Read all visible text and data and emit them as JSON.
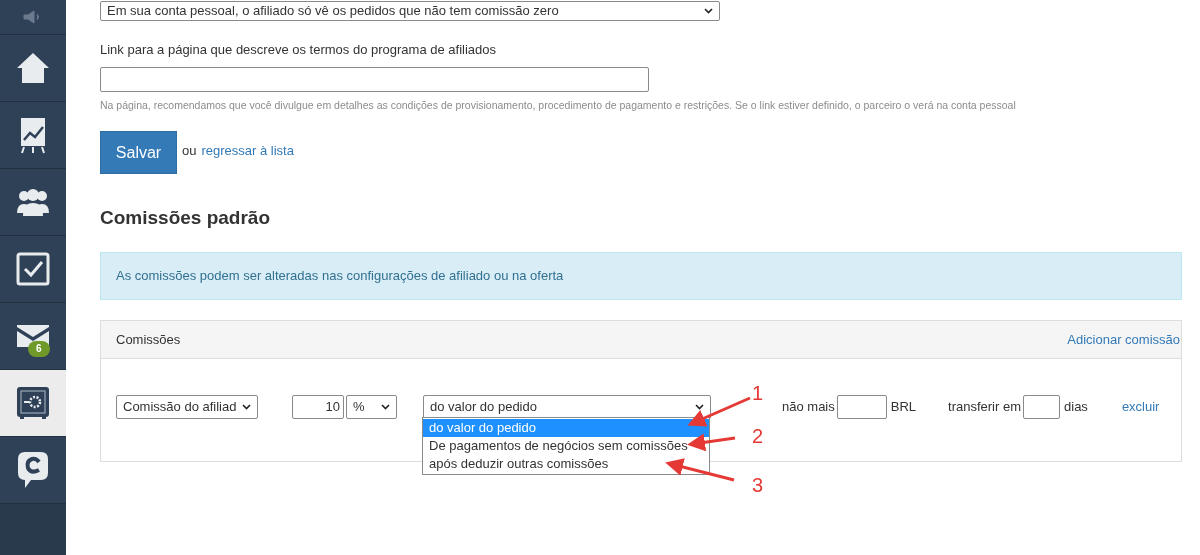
{
  "sidebar": {
    "items": [
      {
        "kind": "speaker",
        "selected": false
      },
      {
        "kind": "home",
        "selected": false
      },
      {
        "kind": "chart",
        "selected": false
      },
      {
        "kind": "people",
        "selected": false
      },
      {
        "kind": "check",
        "selected": false
      },
      {
        "kind": "mail",
        "selected": false,
        "badge": "6"
      },
      {
        "kind": "safe",
        "selected": true
      },
      {
        "kind": "chat",
        "selected": false
      }
    ]
  },
  "visibility_select": {
    "value": "Em sua conta pessoal, o afiliado só vê os pedidos que não tem comissão zero"
  },
  "terms_link": {
    "label": "Link para a página que descreve os termos do programa de afiliados",
    "hint": "Na página, recomendamos que você divulgue em detalhes as condições de provisionamento, procedimento de pagamento e restrições. Se o link estiver definido, o parceiro o verá na conta pessoal"
  },
  "save_button": "Salvar",
  "or_text": "ou",
  "back_link": "regressar à lista",
  "section_title": "Comissões padrão",
  "info": "As comissões podem ser alteradas nas configurações de afiliado ou na oferta",
  "panel": {
    "title": "Comissões",
    "add_link": "Adicionar comissão",
    "row": {
      "type_select": "Comissão do afiliad",
      "amount": "10",
      "unit_select": "%",
      "base_select": "do valor do pedido",
      "base_options": [
        {
          "label": "do valor do pedido",
          "selected": true
        },
        {
          "label": "De pagamentos de negócios sem comissões",
          "selected": false
        },
        {
          "label": "após deduzir outras comissões",
          "selected": false
        }
      ],
      "max_label": "não mais",
      "currency": "BRL",
      "transfer_label": "transferir em",
      "days": "dias",
      "delete_link": "excluir"
    }
  },
  "annotations": [
    "1",
    "2",
    "3"
  ]
}
